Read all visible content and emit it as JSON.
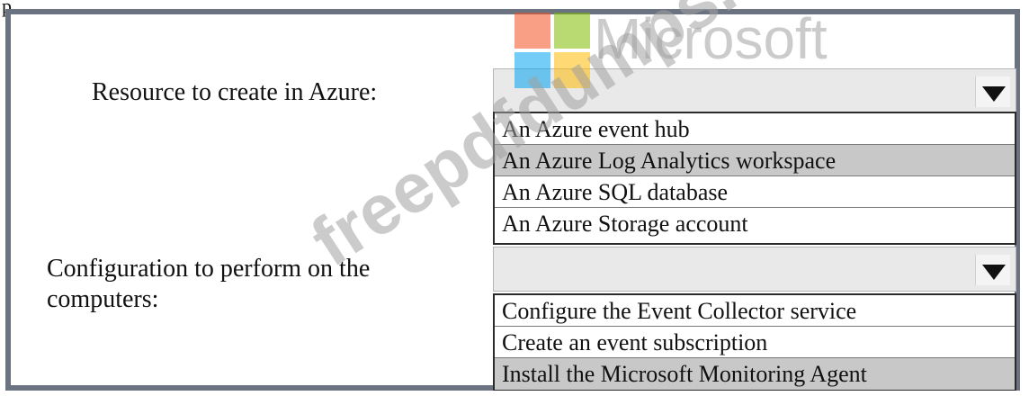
{
  "page": {
    "top_label": "p"
  },
  "question": {
    "resource": {
      "label": "Resource to create in Azure:",
      "options": [
        "An Azure event hub",
        "An Azure Log Analytics workspace",
        "An Azure SQL database",
        "An Azure Storage account"
      ],
      "selected_index": 1
    },
    "configuration": {
      "label_line1": "Configuration to perform on the",
      "label_line2": "computers:",
      "options": [
        "Configure the Event Collector service",
        "Create an event subscription",
        "Install the Microsoft Monitoring Agent"
      ],
      "selected_index": 2
    }
  },
  "watermarks": {
    "brand_text": "Microsoft",
    "site_text": "freepdfdumps.com"
  },
  "colors": {
    "frame": "#6b7280",
    "selected_option": "#c8c8c8",
    "dropdown_bg": "#e9e9e9",
    "logo_red": "#f25022",
    "logo_green": "#7fba00",
    "logo_blue": "#00a4ef",
    "logo_yellow": "#ffb900"
  }
}
